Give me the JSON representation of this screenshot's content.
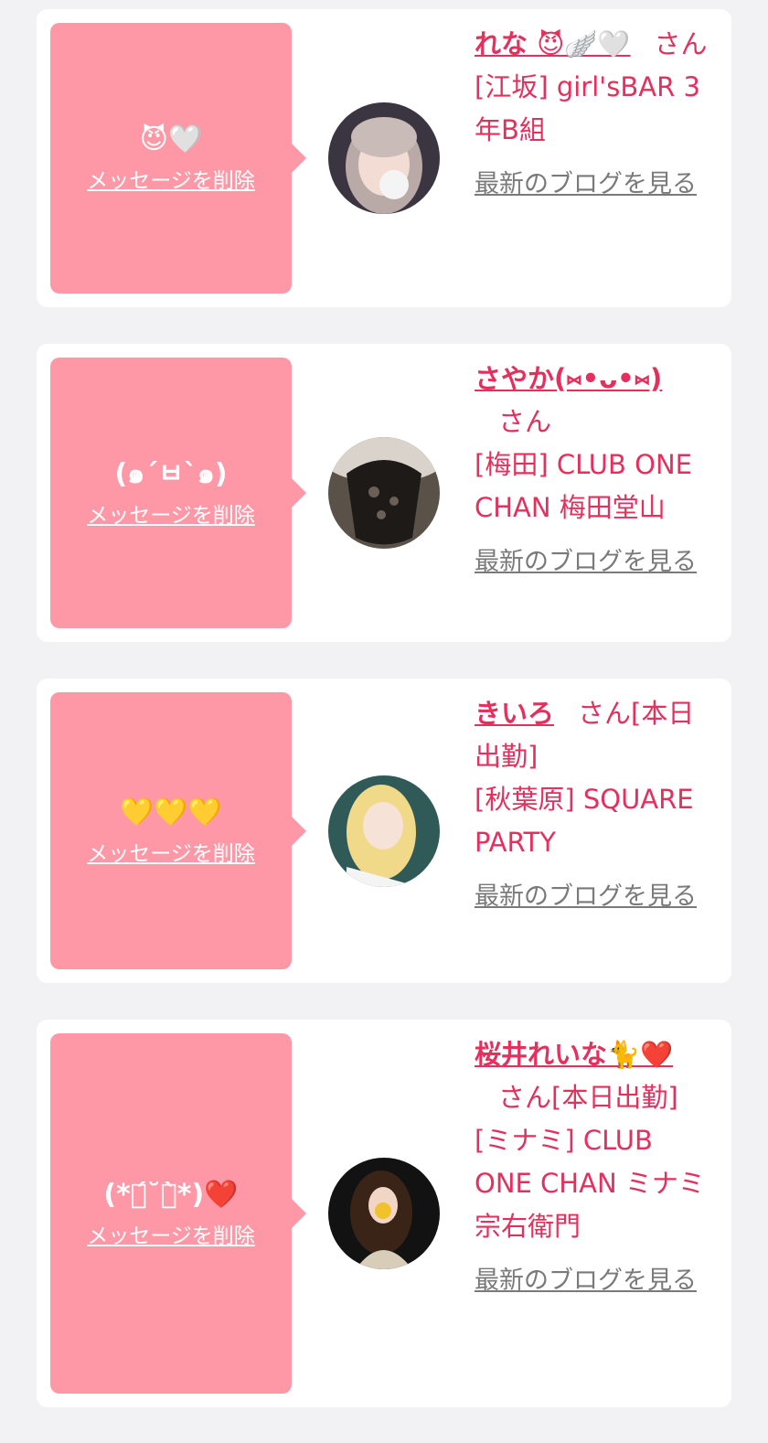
{
  "cards": [
    {
      "message": "😈🤍",
      "delete_label": "メッセージを削除",
      "name": "れな 😈🪽🤍",
      "san": "さん",
      "shift": "",
      "shop": "[江坂] girl'sBAR 3年B組",
      "blog_label": "最新のブログを見る"
    },
    {
      "message": "(๑´ㅂ`๑)",
      "delete_label": "メッセージを削除",
      "name": "さやか(⑅•ᴗ•⑅)",
      "san": "さん",
      "shift": "",
      "shop": "[梅田] CLUB ONE CHAN 梅田堂山",
      "blog_label": "最新のブログを見る"
    },
    {
      "message": "💛💛💛",
      "delete_label": "メッセージを削除",
      "name": "きいろ",
      "san": "さん",
      "shift": "[本日出勤]",
      "shop": "[秋葉原] SQUARE PARTY",
      "blog_label": "最新のブログを見る"
    },
    {
      "message": "(*ฅ́˘ฅ̀*)❤️",
      "delete_label": "メッセージを削除",
      "name": "桜井れいな🐈❤️",
      "san": "さん",
      "shift": "[本日出勤]",
      "shop": "[ミナミ] CLUB ONE CHAN ミナミ 宗右衛門",
      "blog_label": "最新のブログを見る"
    }
  ]
}
